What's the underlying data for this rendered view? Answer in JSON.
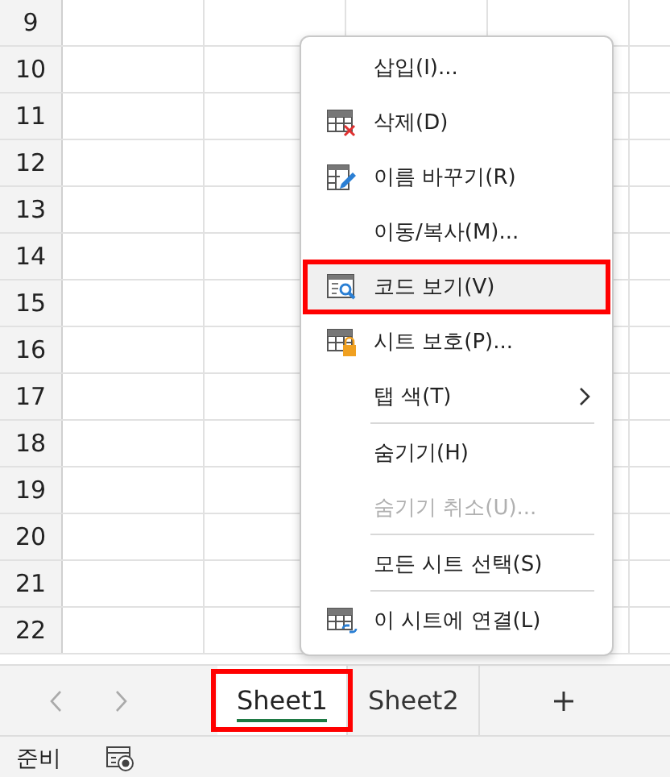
{
  "grid": {
    "row_numbers": [
      "9",
      "10",
      "11",
      "12",
      "13",
      "14",
      "15",
      "16",
      "17",
      "18",
      "19",
      "20",
      "21",
      "22"
    ]
  },
  "context_menu": {
    "items": [
      {
        "label": "삽입(I)...",
        "disabled": false,
        "hovered": false,
        "highlighted": false,
        "submenu": false,
        "separator_after": false
      },
      {
        "label": "삭제(D)",
        "disabled": false,
        "hovered": false,
        "highlighted": false,
        "submenu": false,
        "separator_after": false
      },
      {
        "label": "이름 바꾸기(R)",
        "disabled": false,
        "hovered": false,
        "highlighted": false,
        "submenu": false,
        "separator_after": false
      },
      {
        "label": "이동/복사(M)...",
        "disabled": false,
        "hovered": false,
        "highlighted": false,
        "submenu": false,
        "separator_after": false
      },
      {
        "label": "코드 보기(V)",
        "disabled": false,
        "hovered": true,
        "highlighted": true,
        "submenu": false,
        "separator_after": false
      },
      {
        "label": "시트 보호(P)...",
        "disabled": false,
        "hovered": false,
        "highlighted": false,
        "submenu": false,
        "separator_after": false
      },
      {
        "label": "탭 색(T)",
        "disabled": false,
        "hovered": false,
        "highlighted": false,
        "submenu": true,
        "separator_after": true
      },
      {
        "label": "숨기기(H)",
        "disabled": false,
        "hovered": false,
        "highlighted": false,
        "submenu": false,
        "separator_after": false
      },
      {
        "label": "숨기기 취소(U)...",
        "disabled": true,
        "hovered": false,
        "highlighted": false,
        "submenu": false,
        "separator_after": true
      },
      {
        "label": "모든 시트 선택(S)",
        "disabled": false,
        "hovered": false,
        "highlighted": false,
        "submenu": false,
        "separator_after": true
      },
      {
        "label": "이 시트에 연결(L)",
        "disabled": false,
        "hovered": false,
        "highlighted": false,
        "submenu": false,
        "separator_after": false
      }
    ]
  },
  "sheet_tabs": [
    {
      "label": "Sheet1",
      "selected": true,
      "highlighted": true
    },
    {
      "label": "Sheet2",
      "selected": false,
      "highlighted": false
    }
  ],
  "status_bar": {
    "text": "준비"
  }
}
